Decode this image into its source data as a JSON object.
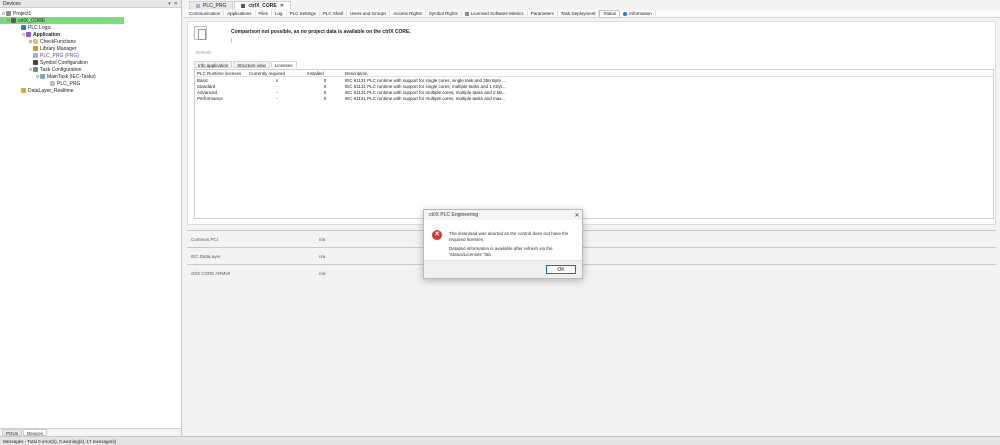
{
  "devices_panel": {
    "title": "Devices",
    "controls": [
      "▾",
      "✕"
    ],
    "tree": [
      {
        "label": "Project1",
        "indent": 0,
        "icon": "project-icon"
      },
      {
        "label": "ctrlX_CORE",
        "indent": 1,
        "icon": "device-icon",
        "selected": true
      },
      {
        "label": "PLC Logic",
        "indent": 2,
        "icon": "plc-logic-icon"
      },
      {
        "label": "Application",
        "indent": 3,
        "icon": "application-icon",
        "bold": true
      },
      {
        "label": "CheckFunctions",
        "indent": 4,
        "icon": "folder-icon"
      },
      {
        "label": "Library Manager",
        "indent": 4,
        "icon": "library-icon"
      },
      {
        "label": "PLC_PRG (PRG)",
        "indent": 4,
        "icon": "program-icon",
        "purple": true
      },
      {
        "label": "Symbol Configuration",
        "indent": 4,
        "icon": "symbol-icon"
      },
      {
        "label": "Task Configuration",
        "indent": 4,
        "icon": "task-config-icon"
      },
      {
        "label": "MainTask (IEC-Tasks)",
        "indent": 5,
        "icon": "task-icon"
      },
      {
        "label": "PLC_PRG",
        "indent": 6,
        "icon": "program-icon"
      },
      {
        "label": "DataLayer_Realtime",
        "indent": 2,
        "icon": "datalayer-icon"
      }
    ],
    "bottom_tabs": [
      "POUs",
      "Devices"
    ]
  },
  "doc_tabs": [
    {
      "label": "PLC_PRG",
      "active": false
    },
    {
      "label": "ctrlX_CORE",
      "active": true
    }
  ],
  "sub_tabs": [
    "Communication",
    "Applications",
    "Files",
    "Log",
    "PLC Settings",
    "PLC Shell",
    "Users and Groups",
    "Access Rights",
    "Symbol Rights",
    "Licensed Software Metrics",
    "Parameters",
    "Task Deployment",
    "Status",
    "Information"
  ],
  "status_page": {
    "compare_message": "Comparison not possible, as no project data is available on the ctrlX CORE.",
    "small_mark": "|",
    "refresh_label": "Refresh",
    "info_tabs": [
      "Info application",
      "Structure view",
      "Licenses"
    ],
    "license_table": {
      "headers": [
        "PLC Runtime licenses",
        "Currently required",
        "Installed",
        "Description"
      ],
      "rows": [
        [
          "Basic",
          "x",
          "0",
          "IEC 61131 PLC runtime with support for single cores, single task and 256 Byte ..."
        ],
        [
          "Standard",
          "-",
          "0",
          "IEC 61131 PLC runtime with support for single cores, multiple tasks and 1 Kbyt..."
        ],
        [
          "Advanced",
          "-",
          "0",
          "IEC 61131 PLC runtime with support for multiple cores, multiple tasks and 2 kB..."
        ],
        [
          "Performance",
          "-",
          "0",
          "IEC 61131 PLC runtime with support for multiple cores, multiple tasks and max..."
        ]
      ]
    },
    "groups": [
      {
        "name": "Common.PCI",
        "value": "n/a"
      },
      {
        "name": "IEC.DataLayer",
        "value": "n/a"
      },
      {
        "name": "ctrlX CORE ARMv8",
        "value": "n/a"
      }
    ]
  },
  "dialog": {
    "title": "ctrlX PLC Engineering",
    "close": "✕",
    "message_1": "The download was aborted as the control does not have the required licenses.",
    "message_2": "Detailed information is available after refresh via the 'Status/Licenses' Tab.",
    "ok_label": "OK"
  },
  "statusbar": {
    "text": "Messages - Total 0 error(s), 0 warning(s), 17 message(s)"
  },
  "colors": {
    "selected_node": "#7ddb7d",
    "error_icon": "#d9342b",
    "ok_border": "#0078d4"
  }
}
